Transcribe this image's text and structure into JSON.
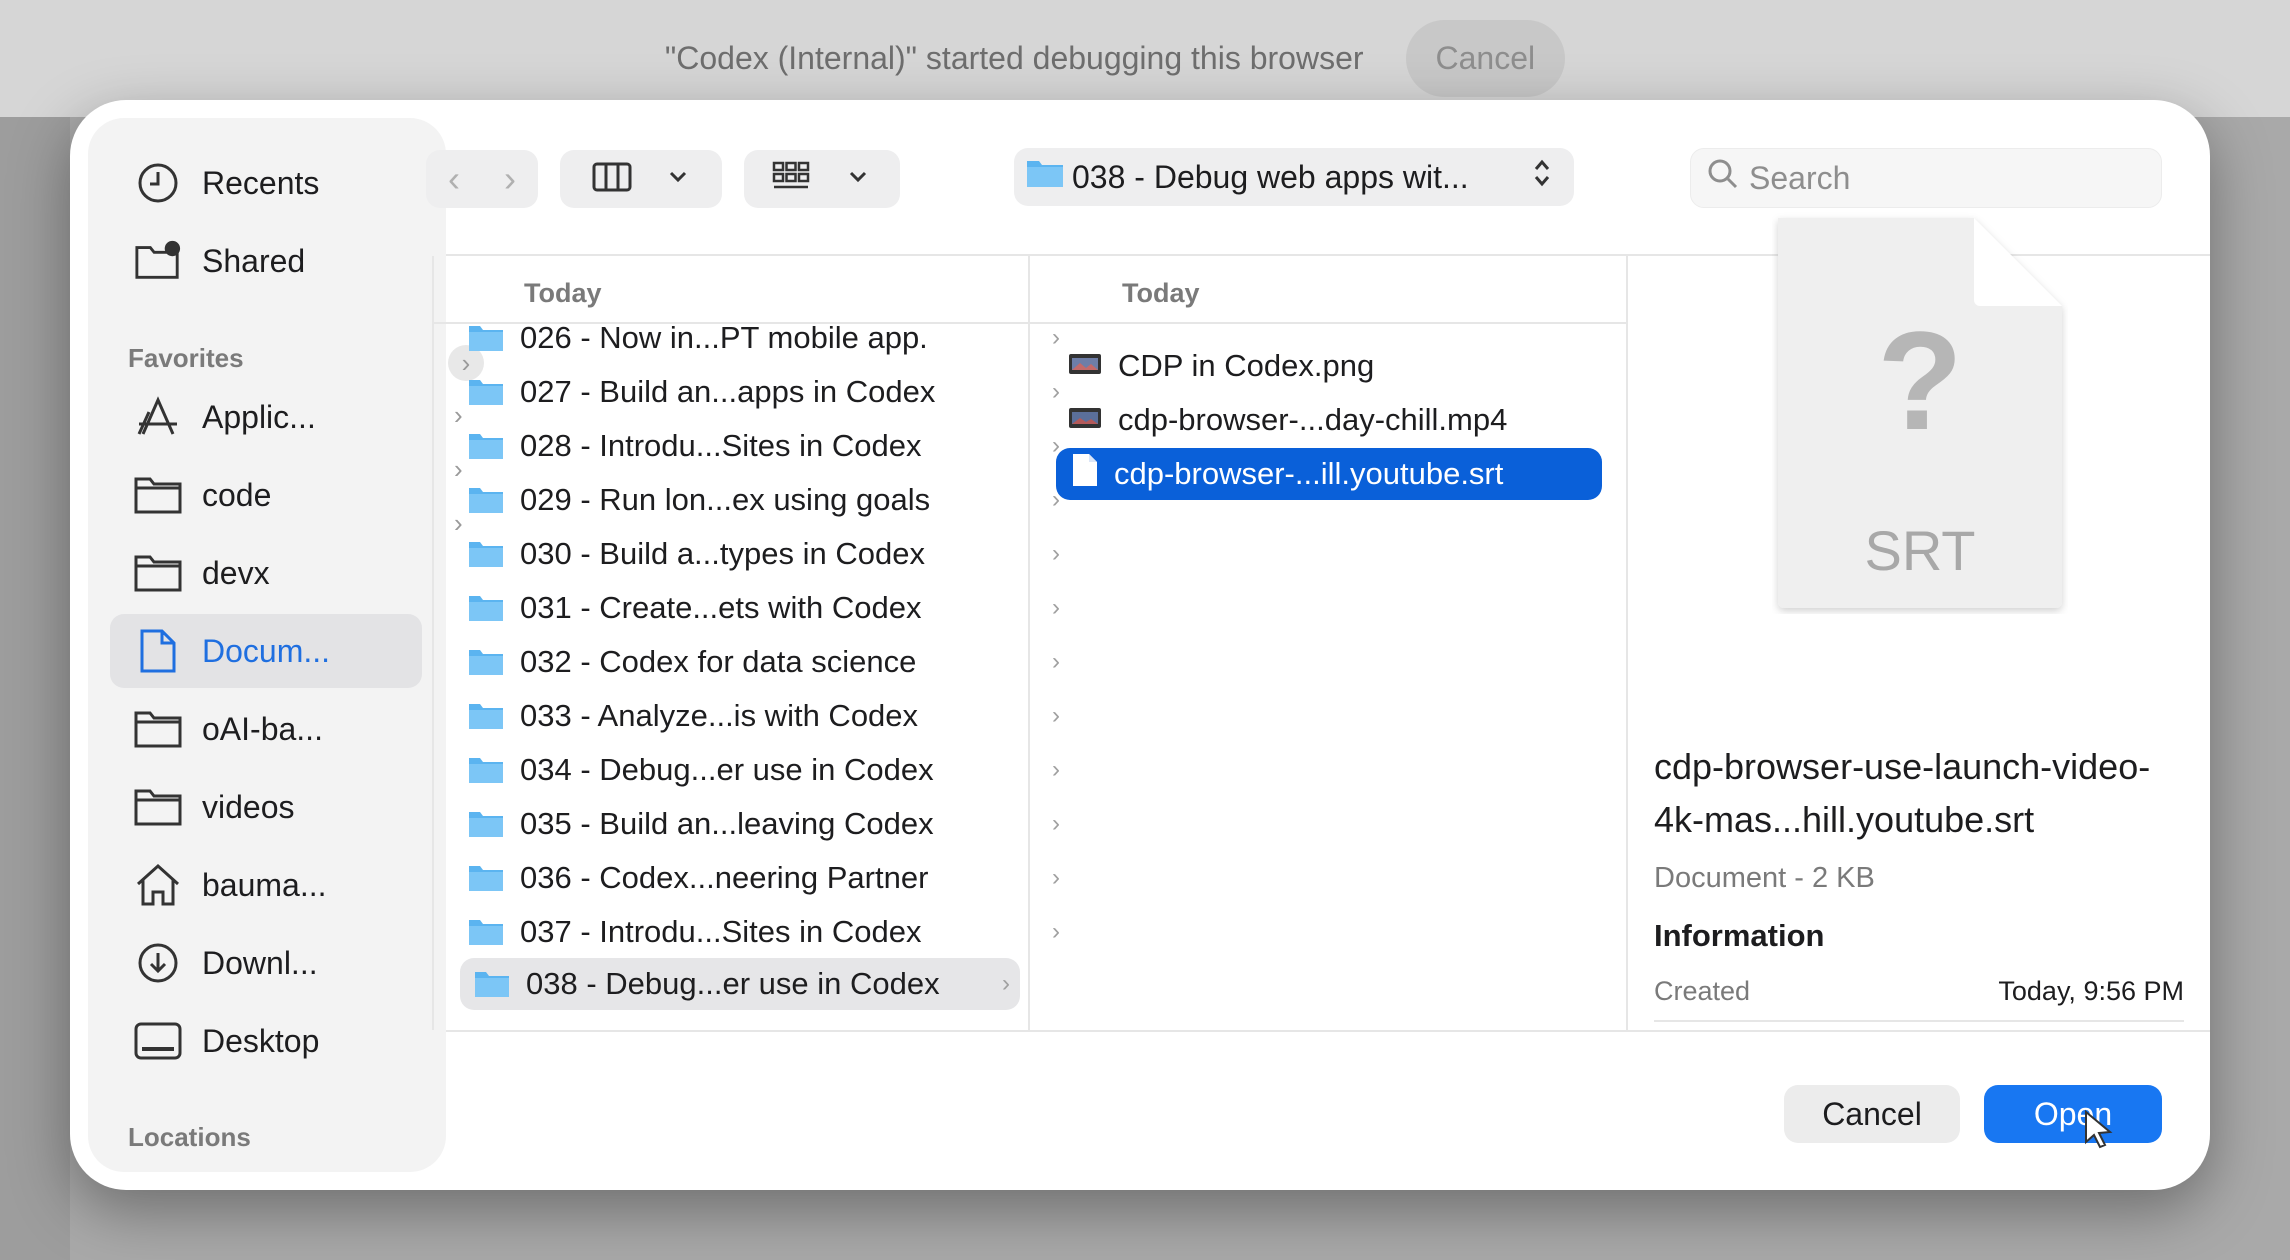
{
  "banner": {
    "message": "\"Codex (Internal)\" started debugging this browser",
    "cancel_label": "Cancel"
  },
  "sidebar": {
    "top_items": [
      {
        "label": "Recents",
        "icon": "clock-icon"
      },
      {
        "label": "Shared",
        "icon": "shared-folder-icon"
      }
    ],
    "favorites_header": "Favorites",
    "favorites": [
      {
        "label": "Applic...",
        "icon": "applications-icon"
      },
      {
        "label": "code",
        "icon": "folder-icon"
      },
      {
        "label": "devx",
        "icon": "folder-icon"
      },
      {
        "label": "Docum...",
        "icon": "document-icon",
        "selected": true
      },
      {
        "label": "oAI-ba...",
        "icon": "folder-icon"
      },
      {
        "label": "videos",
        "icon": "folder-icon"
      },
      {
        "label": "bauma...",
        "icon": "home-icon"
      },
      {
        "label": "Downl...",
        "icon": "download-icon"
      },
      {
        "label": "Desktop",
        "icon": "desktop-icon"
      }
    ],
    "locations_header": "Locations"
  },
  "toolbar": {
    "path_label": "038 - Debug web apps wit...",
    "search_placeholder": "Search"
  },
  "column1": {
    "header": "Today",
    "rows": [
      "026 - Now in...PT mobile app.",
      "027 - Build an...apps in Codex",
      "028 - Introdu...Sites in Codex",
      "029 - Run lon...ex using goals",
      "030 - Build a...types in Codex",
      "031 - Create...ets with Codex",
      "032 - Codex for data science",
      "033 - Analyze...is with Codex",
      "034 - Debug...er use in Codex",
      "035 - Build an...leaving Codex",
      "036 - Codex...neering Partner",
      "037 - Introdu...Sites in Codex",
      "038 - Debug...er use in Codex"
    ],
    "selected_index": 12
  },
  "column2": {
    "header": "Today",
    "rows": [
      {
        "label": "CDP in Codex.png",
        "icon": "image-file-icon"
      },
      {
        "label": "cdp-browser-...day-chill.mp4",
        "icon": "video-file-icon"
      },
      {
        "label": "cdp-browser-...ill.youtube.srt",
        "icon": "document-file-icon",
        "selected": true
      }
    ]
  },
  "preview": {
    "doc_glyph": "?",
    "doc_ext": "SRT",
    "filename": "cdp-browser-use-launch-video-4k-mas...hill.youtube.srt",
    "kind_size": "Document - 2 KB",
    "info_header": "Information",
    "created_label": "Created",
    "created_value": "Today, 9:56 PM"
  },
  "buttons": {
    "cancel": "Cancel",
    "open": "Open"
  },
  "colors": {
    "accent": "#1877f2",
    "selection": "#0a60d9",
    "folder": "#5bb4f0"
  }
}
